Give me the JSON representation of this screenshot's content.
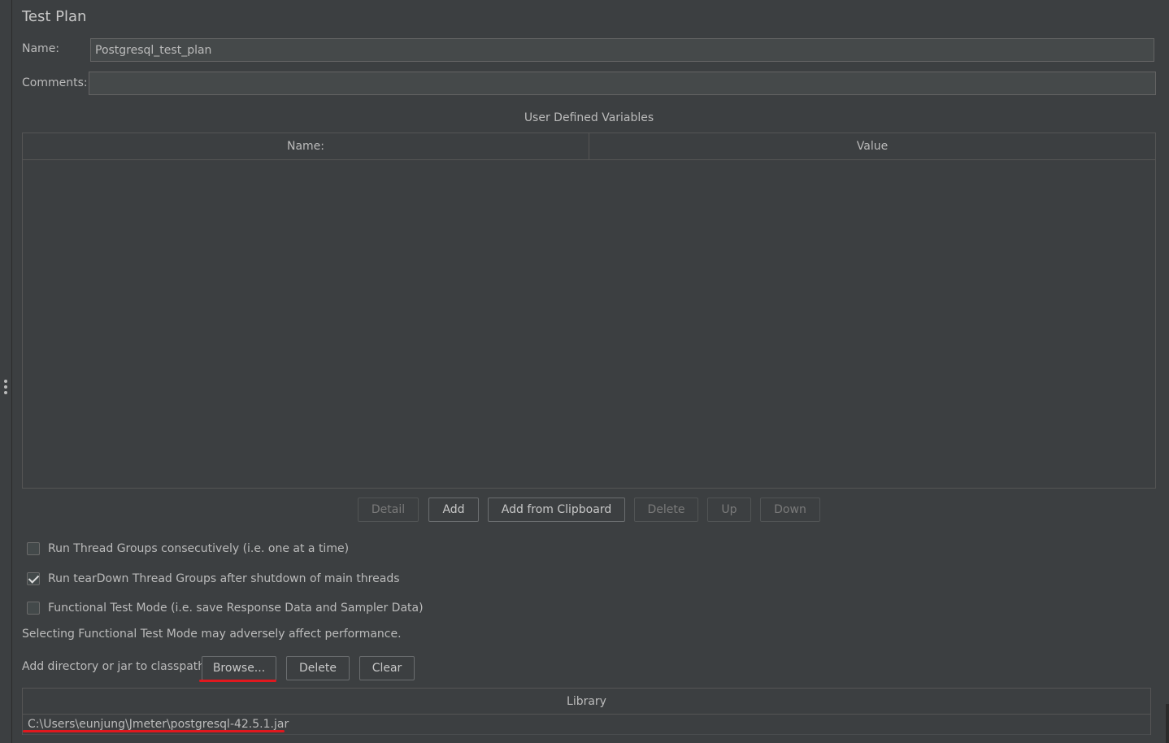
{
  "panel": {
    "title": "Test Plan"
  },
  "form": {
    "name_label": "Name:",
    "name_value": "Postgresql_test_plan",
    "comments_label": "Comments:",
    "comments_value": ""
  },
  "variables": {
    "caption": "User Defined Variables",
    "columns": [
      "Name:",
      "Value"
    ],
    "rows": []
  },
  "variable_buttons": {
    "detail": "Detail",
    "add": "Add",
    "add_clipboard": "Add from Clipboard",
    "delete": "Delete",
    "up": "Up",
    "down": "Down"
  },
  "options": [
    {
      "label": "Run Thread Groups consecutively (i.e. one at a time)",
      "checked": false
    },
    {
      "label": "Run tearDown Thread Groups after shutdown of main threads",
      "checked": true
    },
    {
      "label": "Functional Test Mode (i.e. save Response Data and Sampler Data)",
      "checked": false
    }
  ],
  "functional_note": "Selecting Functional Test Mode may adversely affect performance.",
  "classpath": {
    "label": "Add directory or jar to classpath",
    "browse": "Browse...",
    "delete": "Delete",
    "clear": "Clear"
  },
  "library": {
    "header": "Library",
    "rows": [
      "C:\\Users\\eunjung\\Jmeter\\postgresql-42.5.1.jar"
    ]
  },
  "colors": {
    "background": "#3c3f41",
    "highlight_underline": "#e0181e"
  }
}
